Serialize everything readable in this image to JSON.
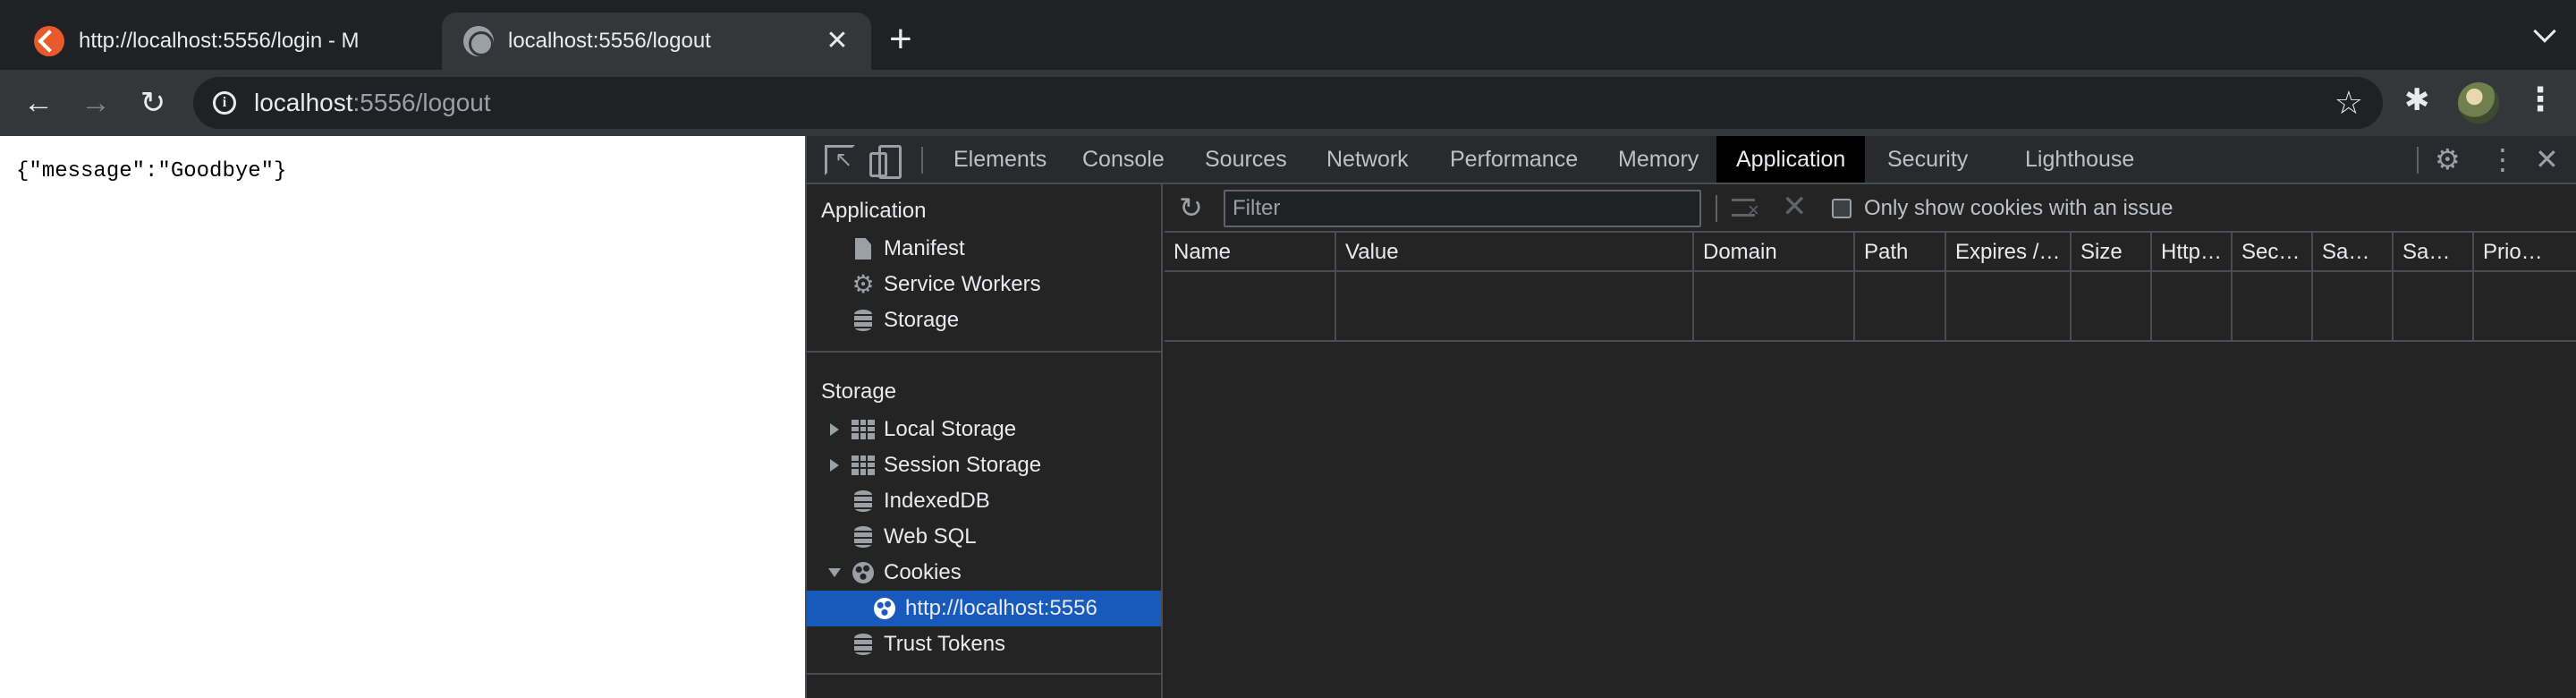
{
  "browser": {
    "tabs": [
      {
        "title": "http://localhost:5556/login - M",
        "close": "✕"
      },
      {
        "title": "localhost:5556/logout",
        "close": "✕"
      }
    ],
    "new_tab": "+",
    "omnibox": {
      "host": "localhost",
      "path": ":5556/logout"
    },
    "icons": {
      "back": "back-arrow-icon",
      "forward": "forward-arrow-icon",
      "reload": "reload-icon",
      "star": "star-icon",
      "extensions": "puzzle-icon",
      "menu": "kebab-menu-icon"
    }
  },
  "page": {
    "body_text": "{\"message\":\"Goodbye\"}"
  },
  "devtools": {
    "tabs": [
      "Elements",
      "Console",
      "Sources",
      "Network",
      "Performance",
      "Memory",
      "Application",
      "Security",
      "Lighthouse"
    ],
    "active_tab": "Application",
    "sidebar": {
      "application_heading": "Application",
      "application_items": [
        "Manifest",
        "Service Workers",
        "Storage"
      ],
      "storage_heading": "Storage",
      "storage_items": [
        "Local Storage",
        "Session Storage",
        "IndexedDB",
        "Web SQL",
        "Cookies",
        "Trust Tokens"
      ],
      "cookie_origin": "http://localhost:5556"
    },
    "cookies": {
      "filter_placeholder": "Filter",
      "only_issues_label": "Only show cookies with an issue",
      "only_issues_checked": false,
      "columns": [
        "Name",
        "Value",
        "Domain",
        "Path",
        "Expires /…",
        "Size",
        "Http…",
        "Sec…",
        "Sa…",
        "Sa…",
        "Prio…"
      ],
      "rows": []
    },
    "accent_color": "#185abc"
  }
}
